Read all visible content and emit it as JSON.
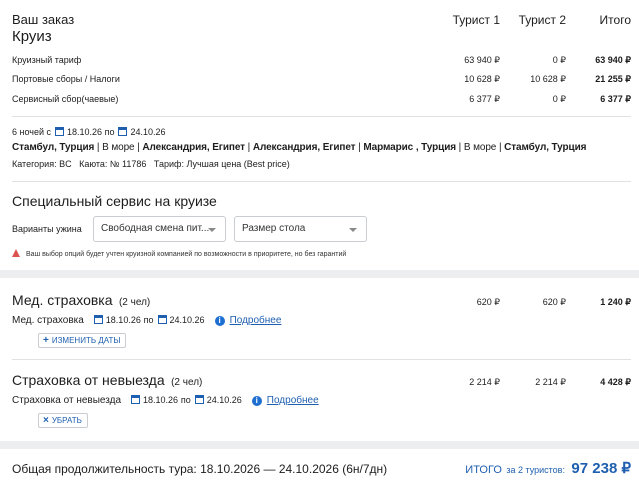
{
  "order": {
    "title": "Ваш заказ",
    "subtitle": "Круиз",
    "columns": [
      "Турист 1",
      "Турист 2",
      "Итого"
    ],
    "rows": [
      {
        "label": "Круизный тариф",
        "t1": "63 940 ₽",
        "t2": "0 ₽",
        "total": "63 940 ₽"
      },
      {
        "label": "Портовые сборы / Налоги",
        "t1": "10 628 ₽",
        "t2": "10 628 ₽",
        "total": "21 255 ₽"
      },
      {
        "label": "Сервисный сбор(чаевые)",
        "t1": "6 377 ₽",
        "t2": "0 ₽",
        "total": "6 377 ₽"
      }
    ]
  },
  "itinerary": {
    "nights": "6 ночей с",
    "from_date": "18.10.26",
    "to_word": "по",
    "to_date": "24.10.26",
    "route": [
      {
        "text": "Стамбул, Турция",
        "bold": true
      },
      {
        "text": " | ",
        "bold": false
      },
      {
        "text": "В море",
        "bold": false
      },
      {
        "text": " | ",
        "bold": false
      },
      {
        "text": "Александрия, Египет",
        "bold": true
      },
      {
        "text": " | ",
        "bold": false
      },
      {
        "text": "Александрия, Египет",
        "bold": true
      },
      {
        "text": " | ",
        "bold": false
      },
      {
        "text": "Мармарис , Турция",
        "bold": true
      },
      {
        "text": " | ",
        "bold": false
      },
      {
        "text": "В море",
        "bold": false
      },
      {
        "text": " | ",
        "bold": false
      },
      {
        "text": "Стамбул, Турция",
        "bold": true
      }
    ],
    "category": "Категория: BC   Каюта: № 11786   Тариф: Лучшая цена (Best price)"
  },
  "special": {
    "title": "Специальный сервис на круизе",
    "dinner_label": "Варианты ужина",
    "dinner_value": "Свободная смена пит...",
    "table_value": "Размер стола",
    "warning": "Ваш выбор опций будет учтен круизной компанией по возможности в приоритете, но без гарантий"
  },
  "med": {
    "title": "Мед. страховка",
    "count": "(2 чел)",
    "t1": "620 ₽",
    "t2": "620 ₽",
    "total": "1 240 ₽",
    "sub_label": "Мед. страховка",
    "from_date": "18.10.26",
    "to_word": "по",
    "to_date": "24.10.26",
    "more": "Подробнее",
    "button": "ИЗМЕНИТЬ ДАТЫ"
  },
  "nonexit": {
    "title": "Страховка от невыезда",
    "count": "(2 чел)",
    "t1": "2 214 ₽",
    "t2": "2 214 ₽",
    "total": "4 428 ₽",
    "sub_label": "Страховка от невыезда",
    "from_date": "18.10.26",
    "to_word": "по",
    "to_date": "24.10.26",
    "more": "Подробнее",
    "button": "УБРАТЬ"
  },
  "footer": {
    "duration": "Общая продолжительность тура: 18.10.2026 — 24.10.2026 (6н/7дн)",
    "total_label": "ИТОГО",
    "total_for": "за 2 туристов:",
    "total_value": "97 238 ₽"
  },
  "colors": {
    "accent": "#1f5fb0",
    "warning": "#d9534f",
    "background": "#eceef0"
  }
}
